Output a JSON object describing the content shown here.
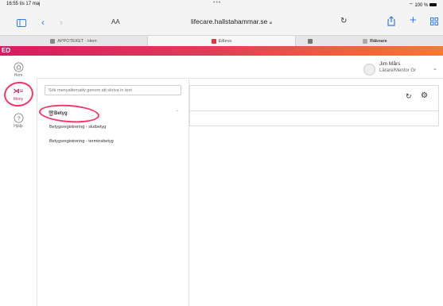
{
  "status_bar": {
    "time": "16:55",
    "date": "tis 17 maj",
    "dots": "•••",
    "battery": "100 %"
  },
  "browser": {
    "text_size_label": "AA",
    "url": "lifecare.hallstahammar.se",
    "tabs": [
      {
        "label": "APPOTEKET - Hem",
        "color": "#8a8a8a"
      },
      {
        "label": "Edlevo",
        "color": "#e0353d"
      },
      {
        "label": "",
        "color": "#777777"
      },
      {
        "label": "Räknare",
        "color": "#aaaaaa"
      }
    ]
  },
  "app": {
    "accent_gradient": [
      "#d81b60",
      "#f27a36"
    ],
    "logo": "ED",
    "nav": [
      {
        "label": "Hem",
        "icon": "home-icon"
      },
      {
        "label": "Meny",
        "icon": "menu-icon"
      },
      {
        "label": "Hjälp",
        "icon": "help-icon"
      }
    ],
    "user": {
      "name": "Jim Mårs",
      "role": "Lärare/Mentor Gr"
    },
    "menu": {
      "search_placeholder": "Sök menyalternativ genom att skriva in text",
      "section": "Betyg",
      "items": [
        "Betygsregistrering - slutbetyg",
        "Betygsregistrering - terminsbetyg"
      ]
    },
    "annotation_color": "#ff3366"
  }
}
